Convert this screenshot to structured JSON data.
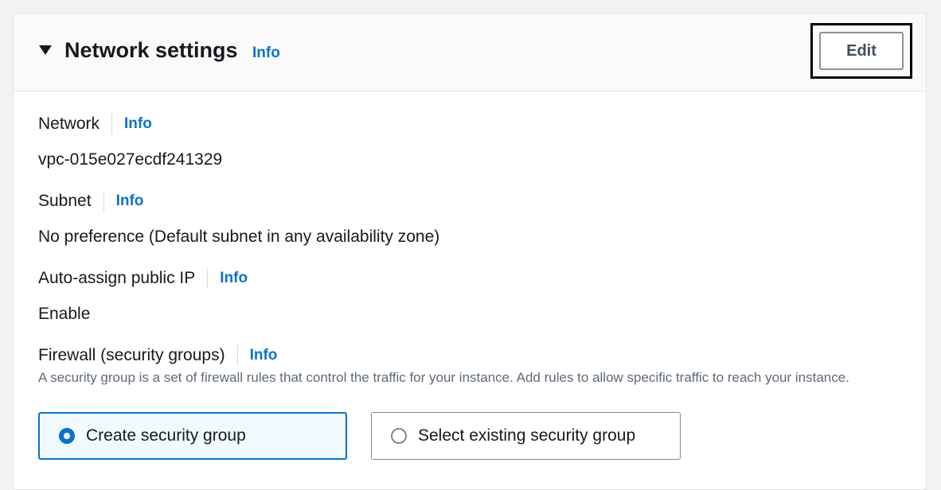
{
  "section": {
    "title": "Network settings",
    "info": "Info",
    "edit_label": "Edit"
  },
  "fields": {
    "network": {
      "label": "Network",
      "info": "Info",
      "value": "vpc-015e027ecdf241329"
    },
    "subnet": {
      "label": "Subnet",
      "info": "Info",
      "value": "No preference (Default subnet in any availability zone)"
    },
    "auto_ip": {
      "label": "Auto-assign public IP",
      "info": "Info",
      "value": "Enable"
    },
    "firewall": {
      "label": "Firewall (security groups)",
      "info": "Info",
      "description": "A security group is a set of firewall rules that control the traffic for your instance. Add rules to allow specific traffic to reach your instance."
    }
  },
  "security_group_options": [
    {
      "label": "Create security group",
      "selected": true
    },
    {
      "label": "Select existing security group",
      "selected": false
    }
  ],
  "colors": {
    "accent": "#0972d3",
    "text": "#16191f",
    "muted": "#5f6b7a"
  }
}
